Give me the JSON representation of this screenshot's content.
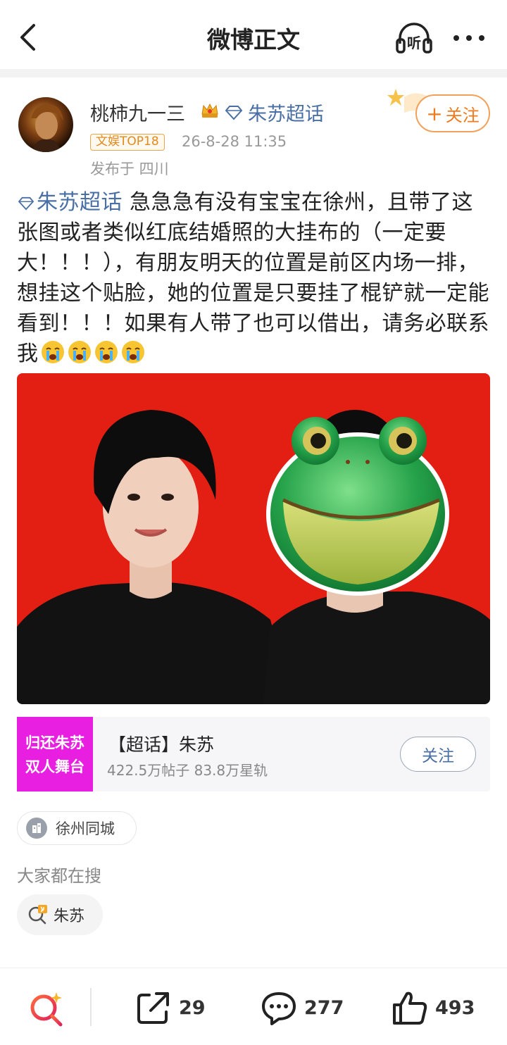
{
  "header": {
    "title": "微博正文",
    "back_icon": "chevron-left-icon",
    "listen_label": "听",
    "more_icon": "more-dots-icon"
  },
  "author": {
    "name": "桃柿九一三",
    "topic": "朱苏超话",
    "badge": "文娱TOP18",
    "time": "26-8-28 11:35",
    "location": "发布于 四川",
    "follow_plus": "+",
    "follow_label": "关注"
  },
  "post": {
    "topic_link": "朱苏超话",
    "text": " 急急急有没有宝宝在徐州，且带了这张图或者类似红底结婚照的大挂布的（一定要大！！！），有朋友明天的位置是前区内场一排，想挂这个贴脸，她的位置是只要挂了棍铲就一定能看到！！！如果有人带了也可以借出，请务必联系我",
    "emoji_count": 4
  },
  "supertopic_card": {
    "thumb_line1": "归还朱苏",
    "thumb_line2": "双人舞台",
    "thumb_color": "#e81fe0",
    "name": "【超话】朱苏",
    "stats": "422.5万帖子 83.8万星轨",
    "follow_label": "关注"
  },
  "location_chip": {
    "label": "徐州同城"
  },
  "search": {
    "heading": "大家都在搜",
    "hot_label": "朱苏"
  },
  "bottom_bar": {
    "repost_count": "29",
    "comment_count": "277",
    "like_count": "493"
  },
  "colors": {
    "link": "#4a6fa5",
    "follow_orange": "#f07a1e",
    "photo_bg": "#e31f14"
  }
}
